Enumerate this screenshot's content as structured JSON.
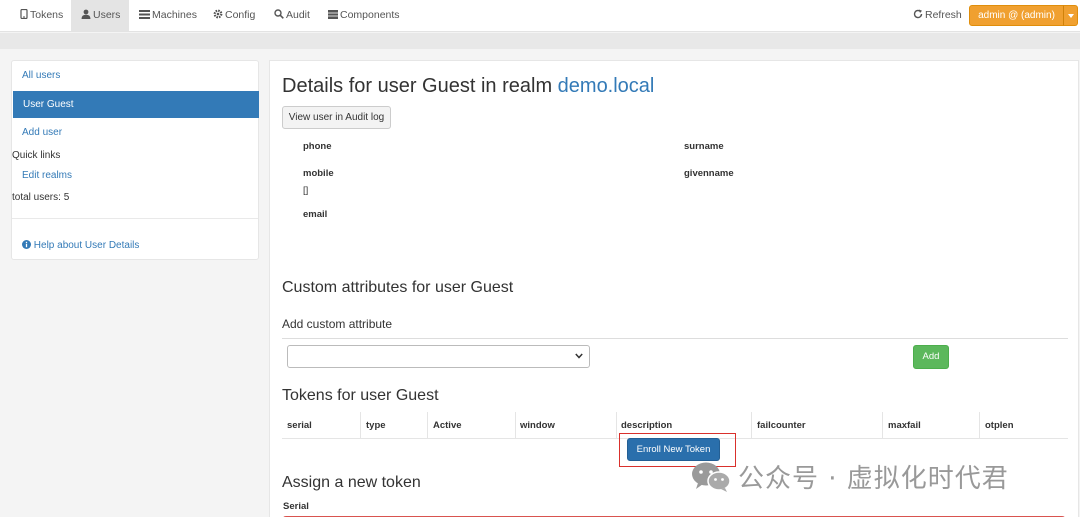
{
  "nav": {
    "items": [
      {
        "label": "Tokens",
        "icon": "phone-icon"
      },
      {
        "label": "Users",
        "icon": "user-icon",
        "active": true
      },
      {
        "label": "Machines",
        "icon": "machines-icon"
      },
      {
        "label": "Config",
        "icon": "gear-icon"
      },
      {
        "label": "Audit",
        "icon": "search-icon"
      },
      {
        "label": "Components",
        "icon": "components-icon"
      }
    ],
    "refresh_label": "Refresh",
    "admin_label": "admin @ (admin)"
  },
  "sidebar": {
    "all_users": "All users",
    "active_item": "User Guest",
    "add_user": "Add user",
    "quick_links": "Quick links",
    "edit_realms": "Edit realms",
    "total_users": "total users: 5",
    "help": "Help about User Details"
  },
  "details": {
    "title_prefix": "Details for user Guest in realm ",
    "realm": "demo.local",
    "audit_button": "View user in Audit log",
    "fields": {
      "phone": "phone",
      "surname": "surname",
      "mobile": "mobile",
      "mobile_value": "[]",
      "givenname": "givenname",
      "email": "email"
    }
  },
  "custom_attributes": {
    "title": "Custom attributes for user Guest",
    "add_title": "Add custom attribute",
    "add_button": "Add"
  },
  "tokens": {
    "title": "Tokens for user Guest",
    "columns": [
      "serial",
      "type",
      "Active",
      "window",
      "description",
      "failcounter",
      "maxfail",
      "otplen"
    ],
    "enroll_button": "Enroll New Token"
  },
  "assign": {
    "title": "Assign a new token",
    "serial_label": "Serial"
  },
  "watermark": {
    "text": "公众号 · 虚拟化时代君"
  },
  "colors": {
    "accent": "#337ab7",
    "admin": "#f0a030",
    "success": "#5cb85c",
    "highlight": "#d9302c"
  }
}
